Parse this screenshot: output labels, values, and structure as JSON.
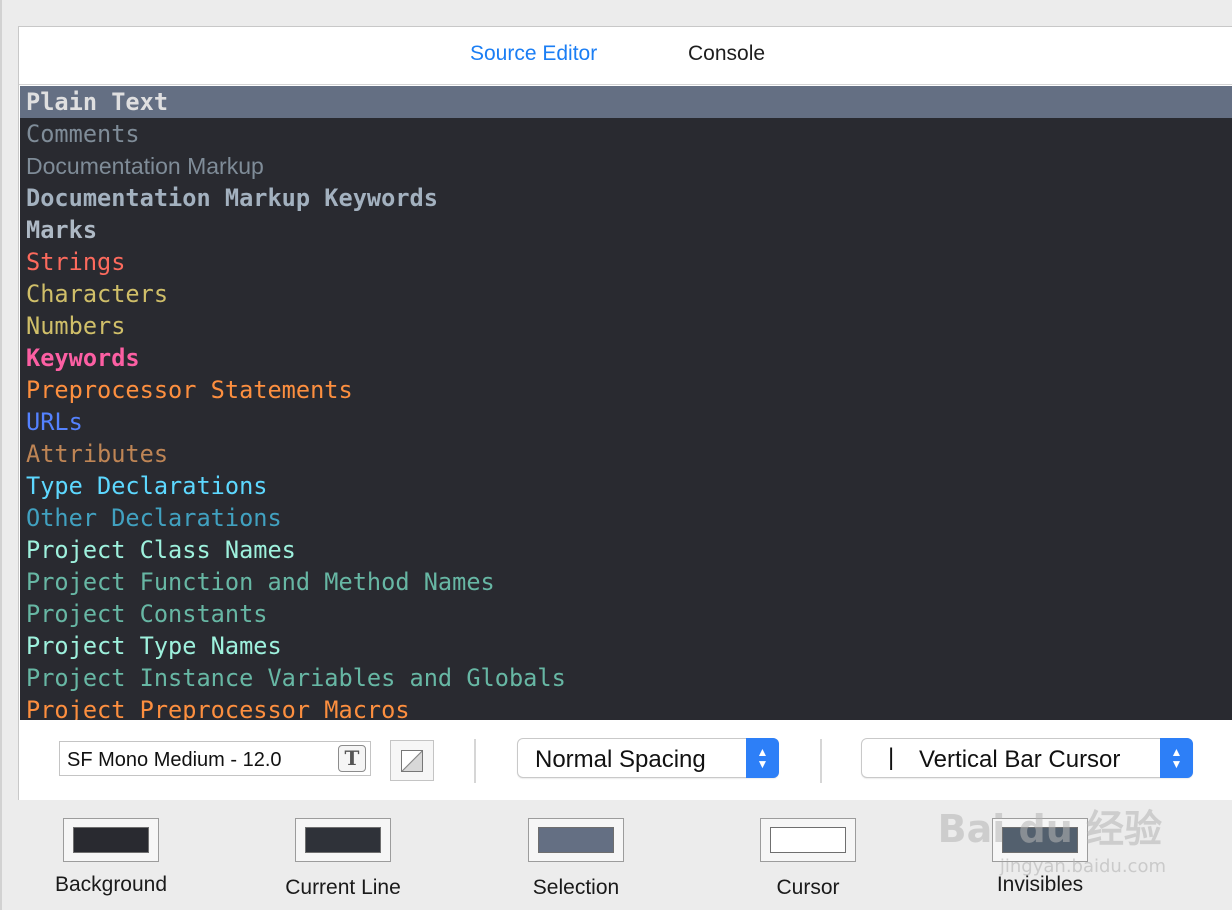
{
  "tabs": [
    {
      "label": "Source Editor",
      "active": true
    },
    {
      "label": "Console",
      "active": false
    }
  ],
  "syntax_items": [
    {
      "label": "Plain Text",
      "color": "#dfdfe0",
      "bold": true,
      "selected": true
    },
    {
      "label": "Comments",
      "color": "#7f8c98",
      "bold": false
    },
    {
      "label": "Documentation Markup",
      "color": "#7f8c98",
      "bold": false,
      "proportional": true
    },
    {
      "label": "Documentation Markup Keywords",
      "color": "#a3b1bf",
      "bold": true
    },
    {
      "label": "Marks",
      "color": "#aeb9c5",
      "bold": true
    },
    {
      "label": "Strings",
      "color": "#fc6a5d",
      "bold": false
    },
    {
      "label": "Characters",
      "color": "#d0bf69",
      "bold": false
    },
    {
      "label": "Numbers",
      "color": "#d0bf69",
      "bold": false
    },
    {
      "label": "Keywords",
      "color": "#fc5fa3",
      "bold": true
    },
    {
      "label": "Preprocessor Statements",
      "color": "#fd8f3f",
      "bold": false
    },
    {
      "label": "URLs",
      "color": "#5482ff",
      "bold": false
    },
    {
      "label": "Attributes",
      "color": "#bf8555",
      "bold": false
    },
    {
      "label": "Type Declarations",
      "color": "#5dd8ff",
      "bold": false
    },
    {
      "label": "Other Declarations",
      "color": "#41a1c0",
      "bold": false
    },
    {
      "label": "Project Class Names",
      "color": "#9ef1dd",
      "bold": false
    },
    {
      "label": "Project Function and Method Names",
      "color": "#67b7a4",
      "bold": false
    },
    {
      "label": "Project Constants",
      "color": "#67b7a4",
      "bold": false
    },
    {
      "label": "Project Type Names",
      "color": "#9ef1dd",
      "bold": false
    },
    {
      "label": "Project Instance Variables and Globals",
      "color": "#67b7a4",
      "bold": false
    },
    {
      "label": "Project Preprocessor Macros",
      "color": "#fd8f3f",
      "bold": false
    }
  ],
  "controls": {
    "font_value": "SF Mono Medium - 12.0",
    "font_picker_glyph": "T",
    "spacing_value": "Normal Spacing",
    "cursor_glyph": "|",
    "cursor_value": "Vertical Bar Cursor"
  },
  "swatches": [
    {
      "label": "Background",
      "color": "#292a30"
    },
    {
      "label": "Current Line",
      "color": "#2f3239"
    },
    {
      "label": "Selection",
      "color": "#646f83"
    },
    {
      "label": "Cursor",
      "color": "#ffffff"
    },
    {
      "label": "Invisibles",
      "color": "#53606e"
    }
  ],
  "colors": {
    "editor_background": "#292a30",
    "selection": "#646f83",
    "accent": "#2d7ff7",
    "active_tab": "#1b7ef4"
  }
}
